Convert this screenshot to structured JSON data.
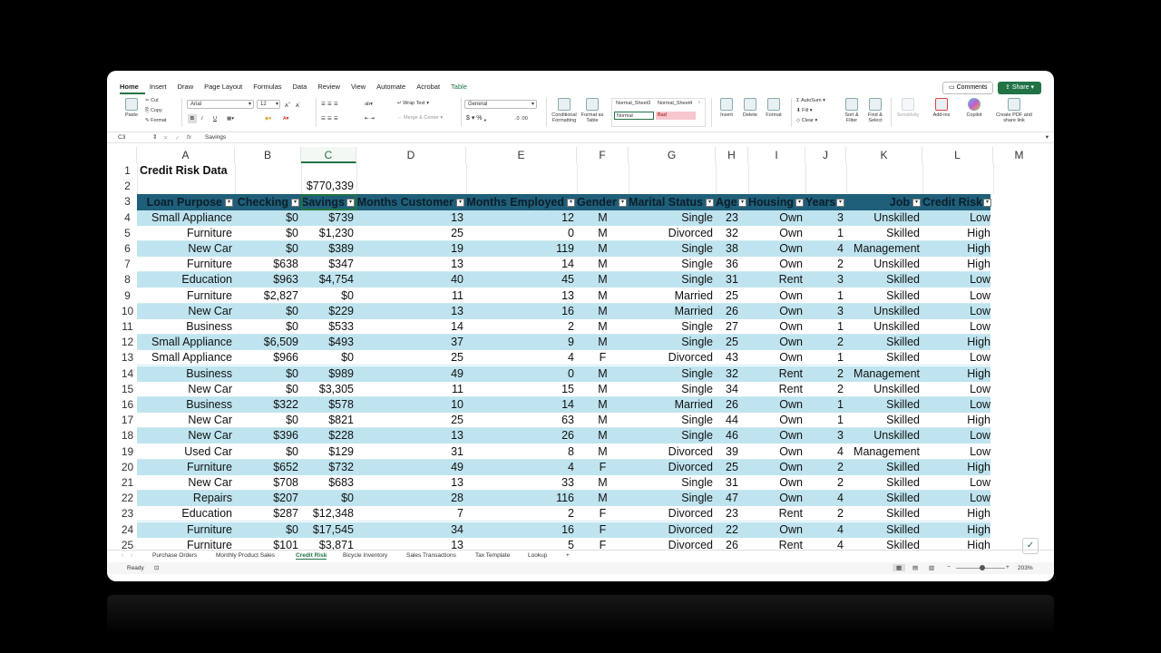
{
  "ribbon_tabs": [
    "Home",
    "Insert",
    "Draw",
    "Page Layout",
    "Formulas",
    "Data",
    "Review",
    "View",
    "Automate",
    "Acrobat",
    "Table"
  ],
  "comments_label": "Comments",
  "share_label": "Share",
  "ribbon": {
    "paste": "Paste",
    "cut": "Cut",
    "copy": "Copy",
    "format": "Format",
    "font_name": "Arial",
    "font_size": "12",
    "bold": "B",
    "italic": "I",
    "underline": "U",
    "wrap_text": "Wrap Text",
    "merge_center": "Merge & Center",
    "number_format": "General",
    "cond_format": "Conditional Formatting",
    "format_as_table": "Format as Table",
    "style_normal3": "Normal_Sheet3",
    "style_normal4": "Normal_Sheet4",
    "style_normal": "Normal",
    "style_bad": "Bad",
    "insert": "Insert",
    "delete": "Delete",
    "format_cells": "Format",
    "autosum": "AutoSum",
    "fill": "Fill",
    "clear": "Clear",
    "sort_filter": "Sort & Filter",
    "find_select": "Find & Select",
    "sensitivity": "Sensitivity",
    "addins": "Add-ins",
    "copilot": "Copilot",
    "create_pdf": "Create PDF and share link"
  },
  "formula_bar": {
    "name_box": "C3",
    "fx": "fx",
    "content": "Savings"
  },
  "columns": [
    "A",
    "B",
    "C",
    "D",
    "E",
    "F",
    "G",
    "H",
    "I",
    "J",
    "K",
    "L",
    "M"
  ],
  "title": "Credit Risk Data",
  "total": "$770,339",
  "table_headers": [
    "Loan Purpose",
    "Checking",
    "Savings",
    "Months Customer",
    "Months Employed",
    "Gender",
    "Marital Status",
    "Age",
    "Housing",
    "Years",
    "Job",
    "Credit Risk"
  ],
  "rows": [
    {
      "n": "4",
      "v": [
        "Small Appliance",
        "$0",
        "$739",
        "13",
        "12",
        "M",
        "Single",
        "23",
        "Own",
        "3",
        "Unskilled",
        "Low"
      ]
    },
    {
      "n": "5",
      "v": [
        "Furniture",
        "$0",
        "$1,230",
        "25",
        "0",
        "M",
        "Divorced",
        "32",
        "Own",
        "1",
        "Skilled",
        "High"
      ]
    },
    {
      "n": "6",
      "v": [
        "New Car",
        "$0",
        "$389",
        "19",
        "119",
        "M",
        "Single",
        "38",
        "Own",
        "4",
        "Management",
        "High"
      ]
    },
    {
      "n": "7",
      "v": [
        "Furniture",
        "$638",
        "$347",
        "13",
        "14",
        "M",
        "Single",
        "36",
        "Own",
        "2",
        "Unskilled",
        "High"
      ]
    },
    {
      "n": "8",
      "v": [
        "Education",
        "$963",
        "$4,754",
        "40",
        "45",
        "M",
        "Single",
        "31",
        "Rent",
        "3",
        "Skilled",
        "Low"
      ]
    },
    {
      "n": "9",
      "v": [
        "Furniture",
        "$2,827",
        "$0",
        "11",
        "13",
        "M",
        "Married",
        "25",
        "Own",
        "1",
        "Skilled",
        "Low"
      ]
    },
    {
      "n": "10",
      "v": [
        "New Car",
        "$0",
        "$229",
        "13",
        "16",
        "M",
        "Married",
        "26",
        "Own",
        "3",
        "Unskilled",
        "Low"
      ]
    },
    {
      "n": "11",
      "v": [
        "Business",
        "$0",
        "$533",
        "14",
        "2",
        "M",
        "Single",
        "27",
        "Own",
        "1",
        "Unskilled",
        "Low"
      ]
    },
    {
      "n": "12",
      "v": [
        "Small Appliance",
        "$6,509",
        "$493",
        "37",
        "9",
        "M",
        "Single",
        "25",
        "Own",
        "2",
        "Skilled",
        "High"
      ]
    },
    {
      "n": "13",
      "v": [
        "Small Appliance",
        "$966",
        "$0",
        "25",
        "4",
        "F",
        "Divorced",
        "43",
        "Own",
        "1",
        "Skilled",
        "Low"
      ]
    },
    {
      "n": "14",
      "v": [
        "Business",
        "$0",
        "$989",
        "49",
        "0",
        "M",
        "Single",
        "32",
        "Rent",
        "2",
        "Management",
        "High"
      ]
    },
    {
      "n": "15",
      "v": [
        "New Car",
        "$0",
        "$3,305",
        "11",
        "15",
        "M",
        "Single",
        "34",
        "Rent",
        "2",
        "Unskilled",
        "Low"
      ]
    },
    {
      "n": "16",
      "v": [
        "Business",
        "$322",
        "$578",
        "10",
        "14",
        "M",
        "Married",
        "26",
        "Own",
        "1",
        "Skilled",
        "Low"
      ]
    },
    {
      "n": "17",
      "v": [
        "New Car",
        "$0",
        "$821",
        "25",
        "63",
        "M",
        "Single",
        "44",
        "Own",
        "1",
        "Skilled",
        "High"
      ]
    },
    {
      "n": "18",
      "v": [
        "New Car",
        "$396",
        "$228",
        "13",
        "26",
        "M",
        "Single",
        "46",
        "Own",
        "3",
        "Unskilled",
        "Low"
      ]
    },
    {
      "n": "19",
      "v": [
        "Used Car",
        "$0",
        "$129",
        "31",
        "8",
        "M",
        "Divorced",
        "39",
        "Own",
        "4",
        "Management",
        "Low"
      ]
    },
    {
      "n": "20",
      "v": [
        "Furniture",
        "$652",
        "$732",
        "49",
        "4",
        "F",
        "Divorced",
        "25",
        "Own",
        "2",
        "Skilled",
        "High"
      ]
    },
    {
      "n": "21",
      "v": [
        "New Car",
        "$708",
        "$683",
        "13",
        "33",
        "M",
        "Single",
        "31",
        "Own",
        "2",
        "Skilled",
        "Low"
      ]
    },
    {
      "n": "22",
      "v": [
        "Repairs",
        "$207",
        "$0",
        "28",
        "116",
        "M",
        "Single",
        "47",
        "Own",
        "4",
        "Skilled",
        "Low"
      ]
    },
    {
      "n": "23",
      "v": [
        "Education",
        "$287",
        "$12,348",
        "7",
        "2",
        "F",
        "Divorced",
        "23",
        "Rent",
        "2",
        "Skilled",
        "High"
      ]
    },
    {
      "n": "24",
      "v": [
        "Furniture",
        "$0",
        "$17,545",
        "34",
        "16",
        "F",
        "Divorced",
        "22",
        "Own",
        "4",
        "Skilled",
        "High"
      ]
    },
    {
      "n": "25",
      "v": [
        "Furniture",
        "$101",
        "$3,871",
        "13",
        "5",
        "F",
        "Divorced",
        "26",
        "Rent",
        "4",
        "Skilled",
        "High"
      ]
    }
  ],
  "sheet_tabs": [
    "Purchase Orders",
    "Monthly Product Sales",
    "Credit Risk",
    "Bicycle Inventory",
    "Sales Transactions",
    "Tax Template",
    "Lookup"
  ],
  "active_sheet": "Credit Risk",
  "add_sheet": "+",
  "status": {
    "ready": "Ready",
    "zoom": "203%"
  },
  "colors": {
    "header_band": "#1f5f7a",
    "band_blue": "#bfe4ef",
    "accent": "#217346"
  }
}
